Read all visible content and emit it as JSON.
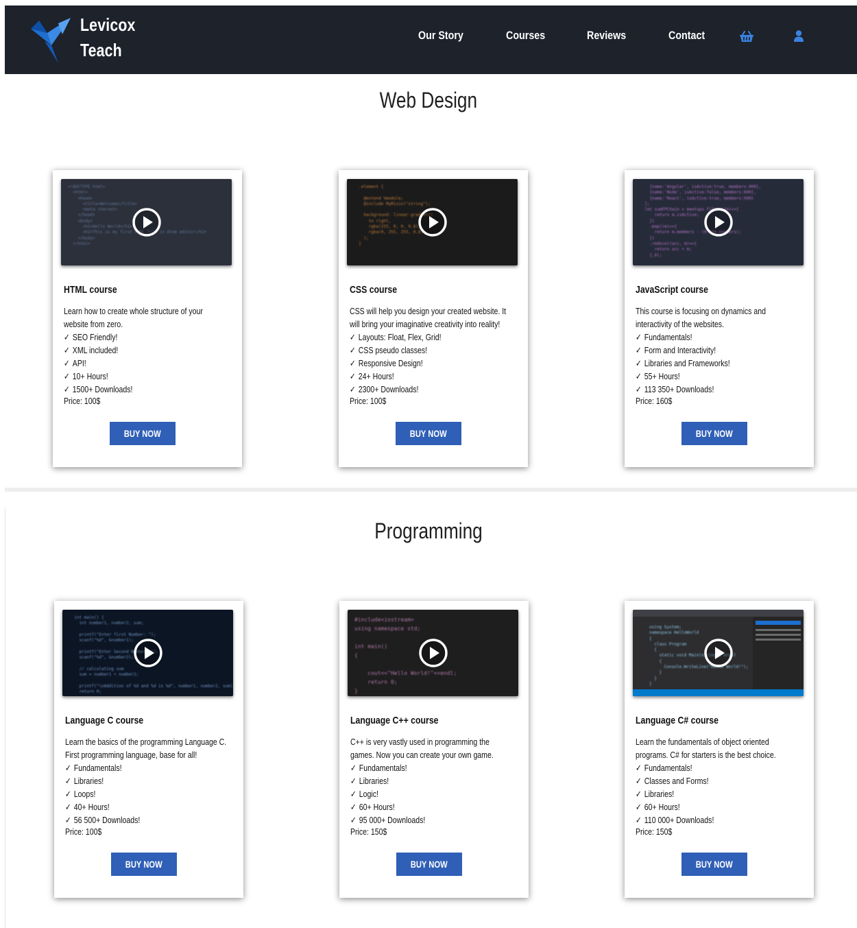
{
  "header": {
    "brand_line1": "Levicox",
    "brand_line2": "Teach",
    "nav": [
      {
        "label": "Our Story"
      },
      {
        "label": "Courses"
      },
      {
        "label": "Reviews"
      },
      {
        "label": "Contact"
      }
    ],
    "icons": [
      "basket-icon",
      "user-icon"
    ],
    "background": "#1d222b",
    "icon_color": "#3b82e0"
  },
  "sections": [
    {
      "title": "Web Design",
      "courses": [
        {
          "title": "HTML course",
          "description": "Learn how to create whole structure of your website from zero.",
          "features": [
            "SEO Friendly!",
            "XML included!",
            "API!",
            "10+ Hours!",
            "1500+ Downloads!"
          ],
          "price": "Price: 100$",
          "button": "BUY NOW"
        },
        {
          "title": "CSS course",
          "description": "CSS will help you design your created website. It will bring your imaginative creativity into reality!",
          "features": [
            "Layouts: Float, Flex, Grid!",
            "CSS pseudo classes!",
            "Responsive Design!",
            "24+ Hours!",
            "2300+ Downloads!"
          ],
          "price": "Price: 100$",
          "button": "BUY NOW"
        },
        {
          "title": "JavaScript course",
          "description": "This course is focusing on dynamics and interactivity of the websites.",
          "features": [
            "Fundamentals!",
            "Form and Interactivity!",
            "Libraries and Frameworks!",
            "55+ Hours!",
            "113 350+ Downloads!"
          ],
          "price": "Price: 160$",
          "button": "BUY NOW"
        }
      ]
    },
    {
      "title": "Programming",
      "courses": [
        {
          "title": "Language C course",
          "description": "Learn the basics of the programming Language C. First programming language, base for all!",
          "features": [
            "Fundamentals!",
            "Libraries!",
            "Loops!",
            "40+ Hours!",
            "56 500+ Downloads!"
          ],
          "price": "Price: 100$",
          "button": "BUY NOW"
        },
        {
          "title": "Language C++ course",
          "description": "C++ is very vastly used in programming the games. Now you can create your own game.",
          "features": [
            "Fundamentals!",
            "Libraries!",
            "Logic!",
            "60+ Hours!",
            "95 000+ Downloads!"
          ],
          "price": "Price: 150$",
          "button": "BUY NOW"
        },
        {
          "title": "Language C# course",
          "description": "Learn the fundamentals of object oriented programs. C# for starters is the best choice.",
          "features": [
            "Fundamentals!",
            "Classes and Forms!",
            "Libraries!",
            "60+ Hours!",
            "110 000+ Downloads!"
          ],
          "price": "Price: 150$",
          "button": "BUY NOW"
        }
      ]
    }
  ],
  "colors": {
    "button": "#2f5fb6",
    "code_bg": "#252a36"
  }
}
